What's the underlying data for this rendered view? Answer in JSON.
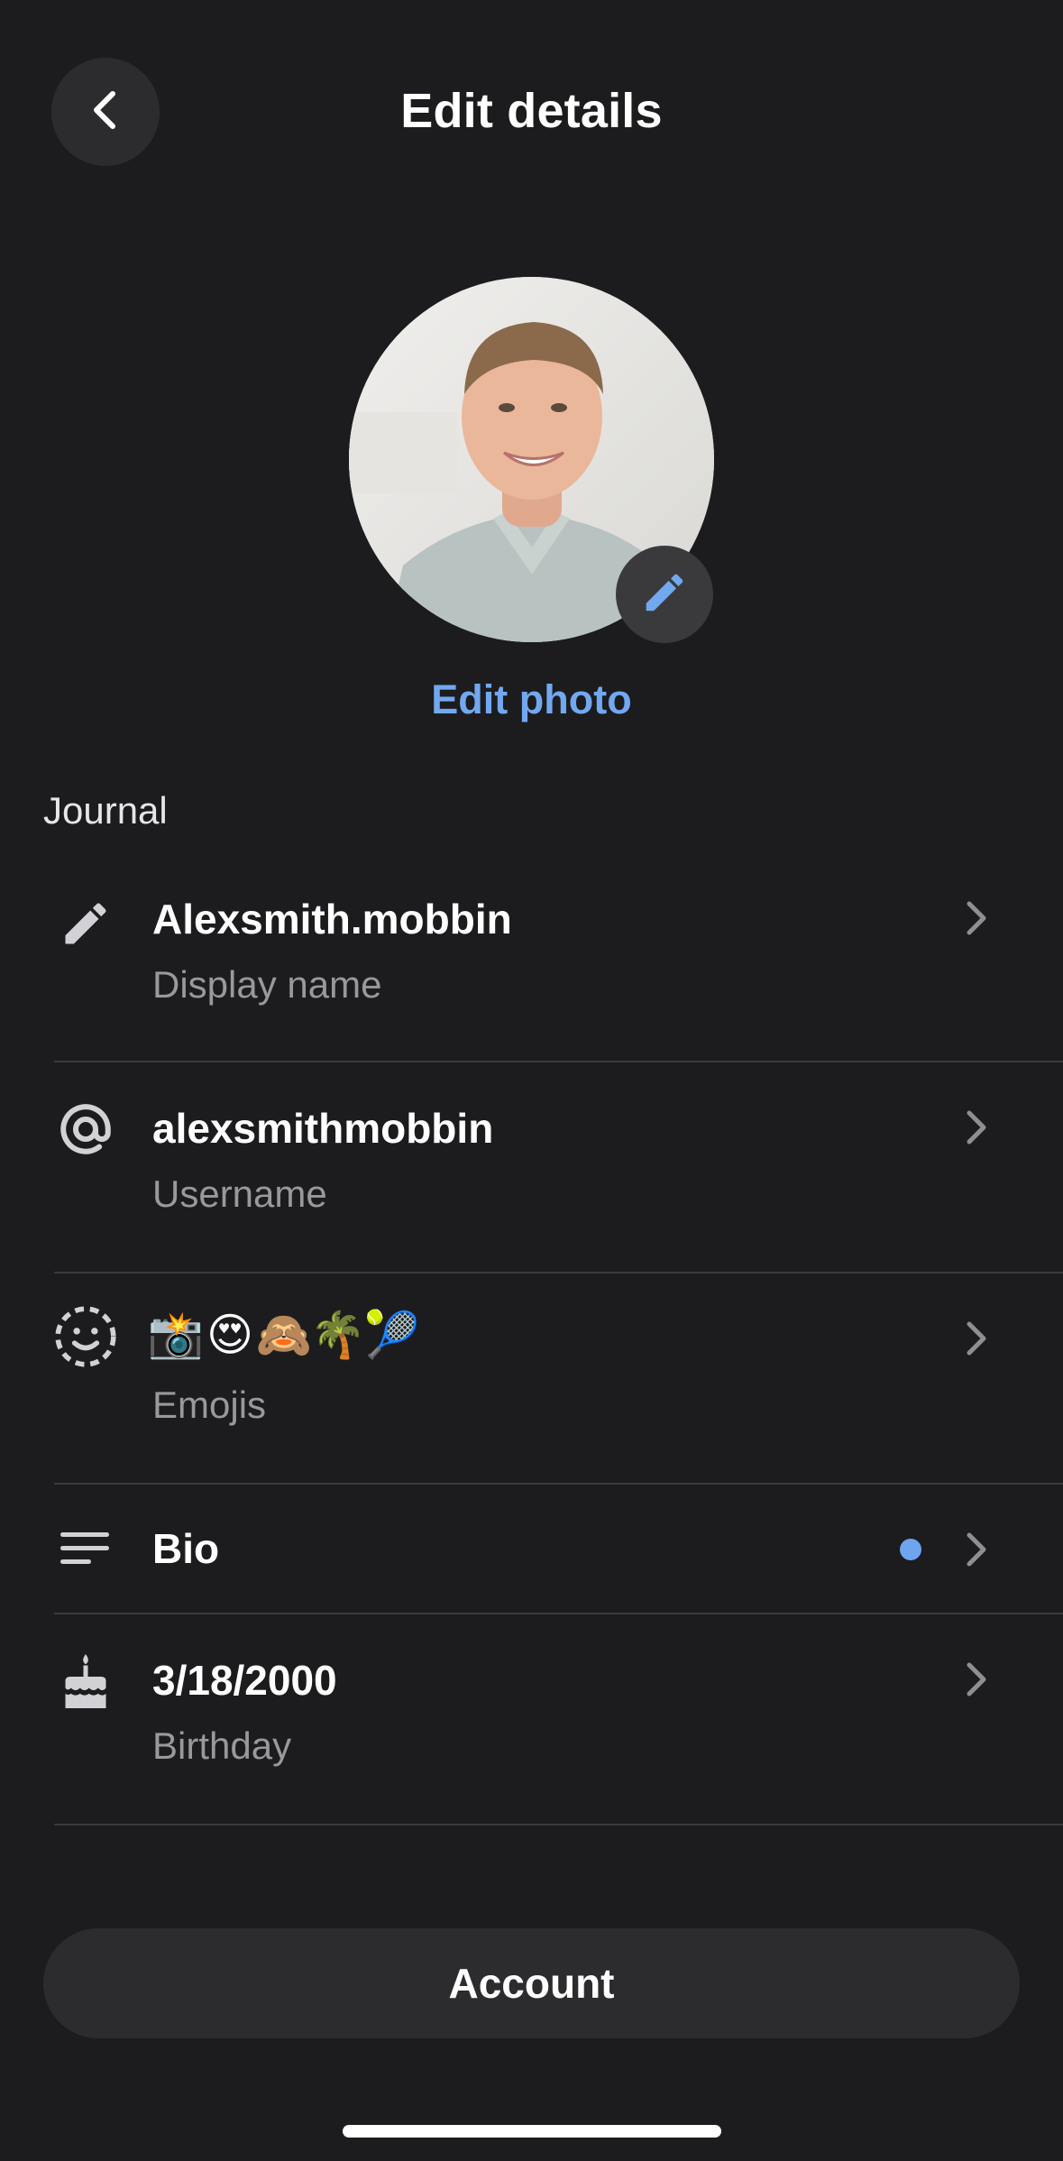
{
  "header": {
    "title": "Edit details",
    "back_icon": "chevron-left-icon"
  },
  "profile": {
    "edit_photo_label": "Edit photo",
    "badge_icon": "pencil-icon"
  },
  "section": {
    "label": "Journal"
  },
  "rows": [
    {
      "icon": "pencil-icon",
      "title": "Alexsmith.mobbin",
      "subtitle": "Display name"
    },
    {
      "icon": "at-sign-icon",
      "title": "alexsmithmobbin",
      "subtitle": "Username"
    },
    {
      "icon": "smiley-dashed-icon",
      "emojis": [
        "📸",
        "😍",
        "🙈",
        "🌴",
        "🎾"
      ],
      "subtitle": "Emojis"
    },
    {
      "icon": "text-lines-icon",
      "title": "Bio",
      "has_dot": true
    },
    {
      "icon": "cake-icon",
      "title": "3/18/2000",
      "subtitle": "Birthday"
    }
  ],
  "account_button": {
    "label": "Account"
  },
  "colors": {
    "background": "#1c1c1e",
    "accent": "#72a8ef",
    "dot": "#6fa4ee",
    "secondary_text": "#98989d"
  }
}
